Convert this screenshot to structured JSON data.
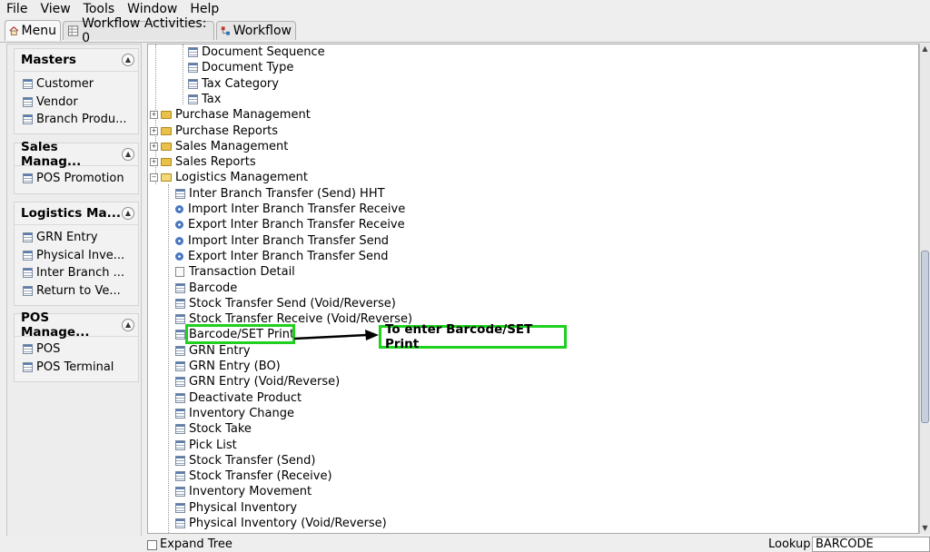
{
  "menubar": {
    "items": [
      "File",
      "View",
      "Tools",
      "Window",
      "Help"
    ]
  },
  "tabs": [
    {
      "label": "Menu"
    },
    {
      "label": "Workflow Activities: 0"
    },
    {
      "label": "Workflow"
    }
  ],
  "sidebar": {
    "panels": [
      {
        "title": "Masters",
        "items": [
          "Customer",
          "Vendor",
          "Branch Produ..."
        ]
      },
      {
        "title": "Sales Manag...",
        "items": [
          "POS Promotion"
        ]
      },
      {
        "title": "Logistics Ma...",
        "items": [
          "GRN Entry",
          "Physical Inve...",
          "Inter Branch ...",
          "Return to Ve..."
        ]
      },
      {
        "title": "POS Manage...",
        "items": [
          "POS",
          "POS Terminal"
        ]
      }
    ]
  },
  "tree": {
    "nodes": [
      {
        "label": "Document Sequence",
        "icon": "document-icon"
      },
      {
        "label": "Document Type",
        "icon": "document-icon"
      },
      {
        "label": "Tax Category",
        "icon": "document-icon"
      },
      {
        "label": "Tax",
        "icon": "document-icon"
      },
      {
        "label": "Purchase Management",
        "icon": "folder-icon"
      },
      {
        "label": "Purchase Reports",
        "icon": "folder-icon"
      },
      {
        "label": "Sales Management",
        "icon": "folder-icon"
      },
      {
        "label": "Sales Reports",
        "icon": "folder-icon"
      },
      {
        "label": "Logistics Management",
        "icon": "folder-open-icon"
      },
      {
        "label": "Inter Branch Transfer (Send) HHT",
        "icon": "document-icon"
      },
      {
        "label": "Import Inter Branch Transfer Receive",
        "icon": "gear-icon"
      },
      {
        "label": "Export Inter Branch Transfer Receive",
        "icon": "gear-icon"
      },
      {
        "label": "Import Inter Branch Transfer Send",
        "icon": "gear-icon"
      },
      {
        "label": "Export Inter Branch Transfer Send",
        "icon": "gear-icon"
      },
      {
        "label": "Transaction Detail",
        "icon": "report-icon"
      },
      {
        "label": "Barcode",
        "icon": "document-icon"
      },
      {
        "label": "Stock Transfer Send (Void/Reverse)",
        "icon": "document-icon"
      },
      {
        "label": "Stock Transfer Receive (Void/Reverse)",
        "icon": "document-icon"
      },
      {
        "label": "Barcode/SET Print",
        "icon": "document-icon"
      },
      {
        "label": "GRN Entry",
        "icon": "document-icon"
      },
      {
        "label": "GRN Entry (BO)",
        "icon": "document-icon"
      },
      {
        "label": "GRN Entry (Void/Reverse)",
        "icon": "document-icon"
      },
      {
        "label": "Deactivate Product",
        "icon": "document-icon"
      },
      {
        "label": "Inventory Change",
        "icon": "document-icon"
      },
      {
        "label": "Stock Take",
        "icon": "document-icon"
      },
      {
        "label": "Pick List",
        "icon": "document-icon"
      },
      {
        "label": "Stock Transfer (Send)",
        "icon": "document-icon"
      },
      {
        "label": "Stock Transfer (Receive)",
        "icon": "document-icon"
      },
      {
        "label": "Inventory Movement",
        "icon": "document-icon"
      },
      {
        "label": "Physical Inventory",
        "icon": "document-icon"
      },
      {
        "label": "Physical Inventory (Void/Reverse)",
        "icon": "document-icon"
      }
    ]
  },
  "annotation": {
    "callout_text": "To enter Barcode/SET Print",
    "highlight_color": "#1fd01f"
  },
  "statusbar": {
    "expand_tree_label": "Expand Tree",
    "lookup_label": "Lookup",
    "lookup_value": "BARCODE"
  }
}
